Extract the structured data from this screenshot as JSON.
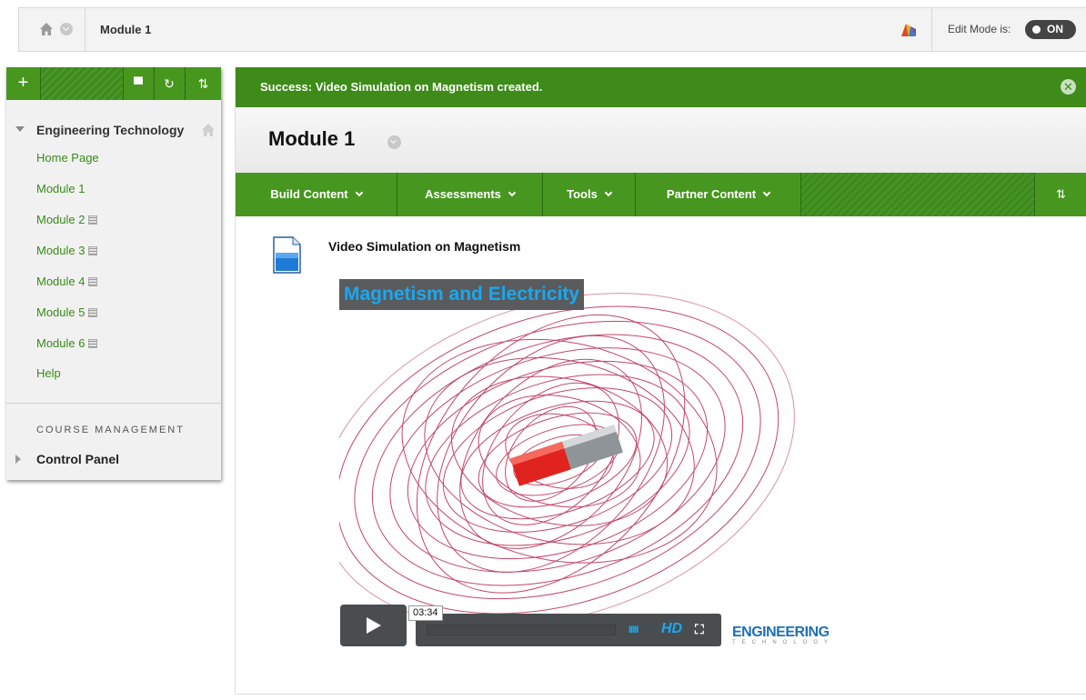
{
  "breadcrumb": {
    "current": "Module 1",
    "edit_mode_label": "Edit Mode is:",
    "edit_mode_value": "ON"
  },
  "course_menu": {
    "toolbar": {
      "add_symbol": "+",
      "folder_symbol": "▀",
      "refresh_symbol": "↻",
      "sort_symbol": "⇅"
    },
    "course_name": "Engineering Technology",
    "items": [
      {
        "label": "Home Page",
        "hidden": false
      },
      {
        "label": "Module 1",
        "hidden": false
      },
      {
        "label": "Module 2",
        "hidden": true
      },
      {
        "label": "Module 3",
        "hidden": true
      },
      {
        "label": "Module 4",
        "hidden": true
      },
      {
        "label": "Module 5",
        "hidden": true
      },
      {
        "label": "Module 6",
        "hidden": true
      },
      {
        "label": "Help",
        "hidden": false
      }
    ],
    "management_heading": "COURSE MANAGEMENT",
    "control_panel": "Control Panel"
  },
  "main": {
    "success_message": "Success: Video Simulation on Magnetism created.",
    "close_symbol": "✕",
    "page_title": "Module 1",
    "action_bar": {
      "build_content": "Build Content",
      "assessments": "Assessments",
      "tools": "Tools",
      "partner_content": "Partner Content",
      "sort_symbol": "⇅"
    },
    "item": {
      "title": "Video Simulation on Magnetism"
    },
    "video": {
      "banner": "Magnetism and Electricity",
      "timecode": "03:34",
      "volume_bars": "IIIII",
      "hd_label": "HD",
      "fullscreen_symbol": "⛶",
      "brand": "ENGINEERING",
      "brand_sub": "TECHNOLOGY"
    }
  },
  "colors": {
    "accent_green": "#3e8b19",
    "link_green": "#3b8a1c",
    "banner_blue": "#19a8f2",
    "field_line": "#b8284f"
  }
}
